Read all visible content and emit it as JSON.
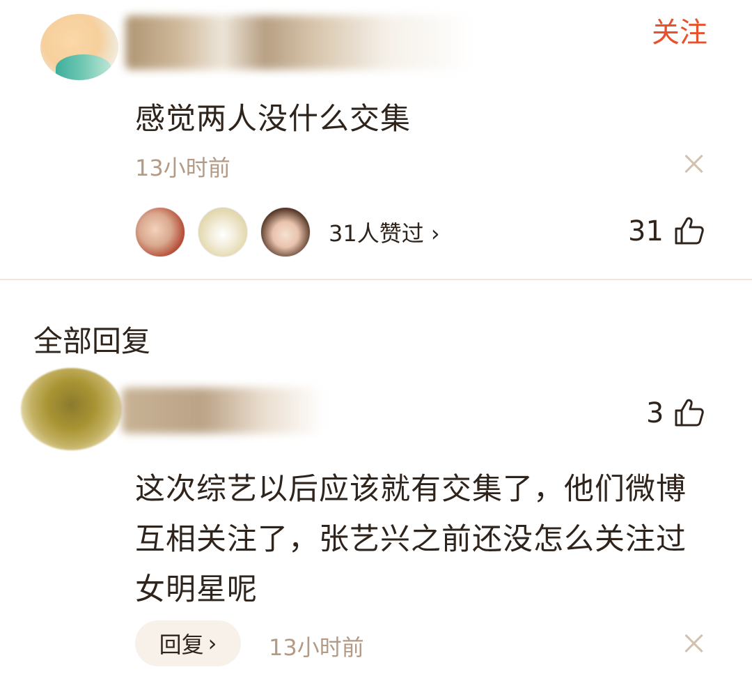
{
  "main_comment": {
    "follow_label": "关注",
    "text": "感觉两人没什么交集",
    "time": "13小时前",
    "likers_text": "31人赞过 ›",
    "like_count": "31"
  },
  "section_title": "全部回复",
  "reply": {
    "like_count": "3",
    "text": "这次综艺以后应该就有交集了，他们微博互相关注了，张艺兴之前还没怎么关注过女明星呢",
    "reply_label": "回复",
    "reply_chevron": "›",
    "time": "13小时前"
  },
  "colors": {
    "follow": "#e8512b",
    "text": "#2f241c",
    "muted": "#b29a85",
    "divider": "#f1e4db"
  }
}
